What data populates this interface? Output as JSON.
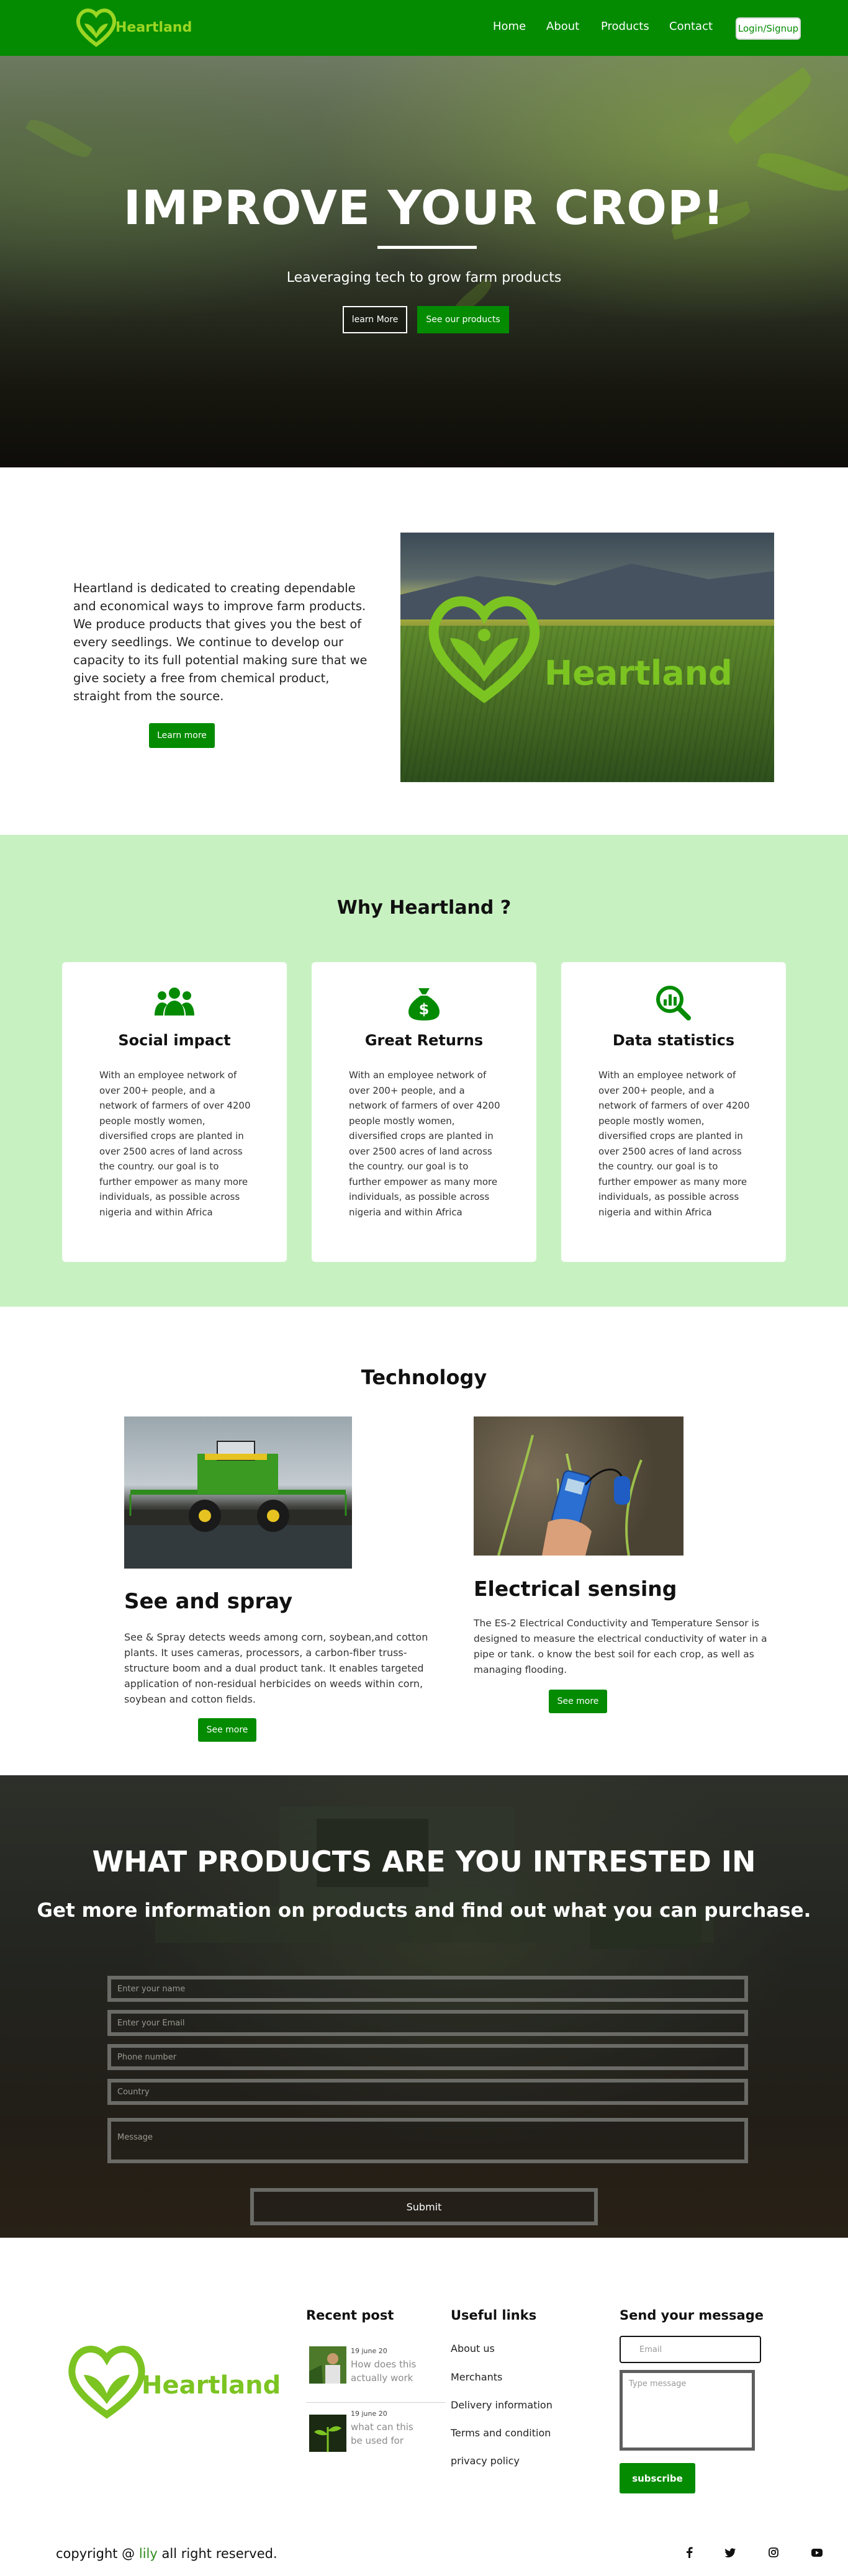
{
  "nav": {
    "brand": "Heartland",
    "links": [
      "Home",
      "About",
      "Products",
      "Contact"
    ],
    "login": "Login/Signup"
  },
  "hero": {
    "title": "IMPROVE YOUR CROP!",
    "subtitle": "Leaveraging tech to grow farm products",
    "learn_more": "learn More",
    "see_products": "See our products"
  },
  "about": {
    "text": "Heartland is dedicated to creating dependable and economical ways to improve farm products. We produce products that gives you the best of every seedlings. We continue to develop our capacity to its full potential making sure that we give society a free from chemical product, straight from the source.",
    "button": "Learn more",
    "image_brand": "Heartland"
  },
  "why": {
    "title": "Why Heartland ?",
    "cards": [
      {
        "icon": "users-icon",
        "title": "Social impact",
        "body": "With an employee network of over 200+ people, and a network of farmers of over 4200 people mostly women, diversified crops are planted in over 2500 acres of land across the country. our goal is to further empower as many more individuals, as possible across nigeria and within Africa"
      },
      {
        "icon": "money-bag-icon",
        "title": "Great Returns",
        "body": "With an employee network of over 200+ people, and a network of farmers of over 4200 people mostly women, diversified crops are planted in over 2500 acres of land across the country. our goal is to further empower as many more individuals, as possible across nigeria and within Africa"
      },
      {
        "icon": "search-chart-icon",
        "title": "Data statistics",
        "body": "With an employee network of over 200+ people, and a network of farmers of over 4200 people mostly women, diversified crops are planted in over 2500 acres of land across the country. our goal is to further empower as many more individuals, as possible across nigeria and within Africa"
      }
    ]
  },
  "technology": {
    "title": "Technology",
    "items": [
      {
        "title": "See and spray",
        "body": "See & Spray detects weeds among corn, soybean,and cotton plants. It uses cameras, processors, a carbon-fiber truss-structure boom and a dual product tank. It enables targeted application of non-residual herbicides on weeds within corn, soybean and cotton fields.",
        "button": "See more"
      },
      {
        "title": "Electrical sensing",
        "body": "The ES-2 Electrical Conductivity and Temperature Sensor is designed to measure the electrical conductivity of water in a pipe or tank. o know the best soil for each crop, as well as managing flooding.",
        "button": "See more"
      }
    ]
  },
  "products": {
    "title": "WHAT PRODUCTS ARE YOU INTRESTED IN",
    "subtitle": "Get more information on products and find out what you can purchase.",
    "name_ph": "Enter your name",
    "email_ph": "Enter your Email",
    "phone_ph": "Phone number",
    "country_ph": "Country",
    "message_ph": "Message",
    "submit": "Submit"
  },
  "footer": {
    "brand": "Heartland",
    "recent_title": "Recent post",
    "posts": [
      {
        "date": "19 june 20",
        "text": "How does this actually work"
      },
      {
        "date": "19 june 20",
        "text": "what can this be used for"
      }
    ],
    "links_title": "Useful links",
    "links": [
      "About us",
      "Merchants",
      "Delivery information",
      "Terms and condition",
      "privacy policy"
    ],
    "message_title": "Send your message",
    "email_ph": "Email",
    "message_ph": "Type message",
    "subscribe": "subscribe",
    "copyright_prefix": "copyright @",
    "copyright_brand": "lily",
    "copyright_suffix": "all right reserved.",
    "social": [
      "f",
      "t",
      "ig",
      "yt"
    ]
  },
  "colors": {
    "brand_green": "#048b02",
    "why_bg": "#c8f1c2",
    "logo_green": "#7cc422"
  }
}
